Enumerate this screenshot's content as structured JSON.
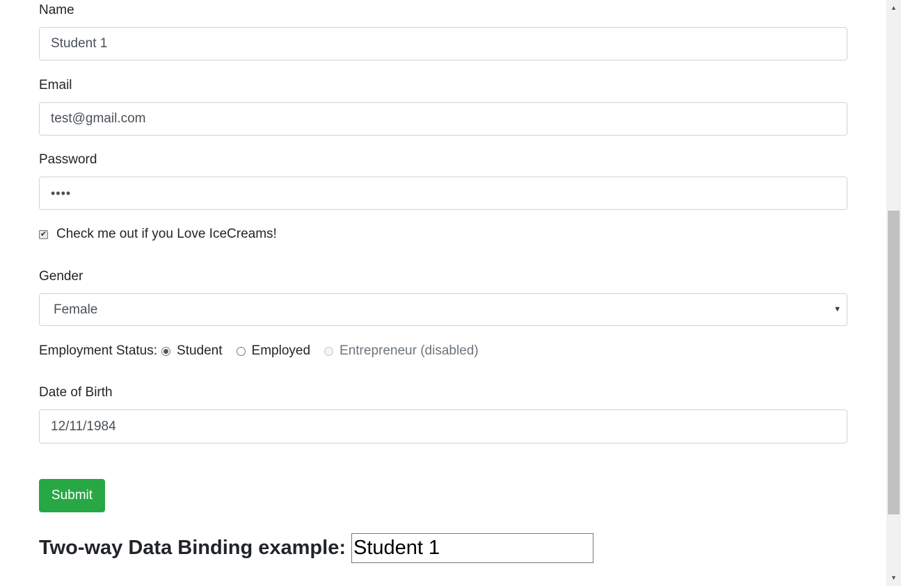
{
  "form": {
    "name_label": "Name",
    "name_value": "Student 1",
    "email_label": "Email",
    "email_value": "test@gmail.com",
    "password_label": "Password",
    "password_display": "••••",
    "checkbox_label": "Check me out if you Love IceCreams!",
    "checkbox_mark": "✔",
    "gender_label": "Gender",
    "gender_selected": "Female",
    "employment_label": "Employment Status:",
    "employment_options": [
      {
        "label": "Student",
        "checked": true,
        "disabled": false
      },
      {
        "label": "Employed",
        "checked": false,
        "disabled": false
      },
      {
        "label": "Entrepreneur (disabled)",
        "checked": false,
        "disabled": true
      }
    ],
    "dob_label": "Date of Birth",
    "dob_value": "12/11/1984",
    "submit_label": "Submit"
  },
  "binding": {
    "title": "Two-way Data Binding example:",
    "value": "Student 1"
  },
  "icons": {
    "select_caret": "▼",
    "scroll_up": "▲",
    "scroll_down": "▼"
  },
  "colors": {
    "submit_bg": "#28a745",
    "input_border": "#ced4da"
  }
}
